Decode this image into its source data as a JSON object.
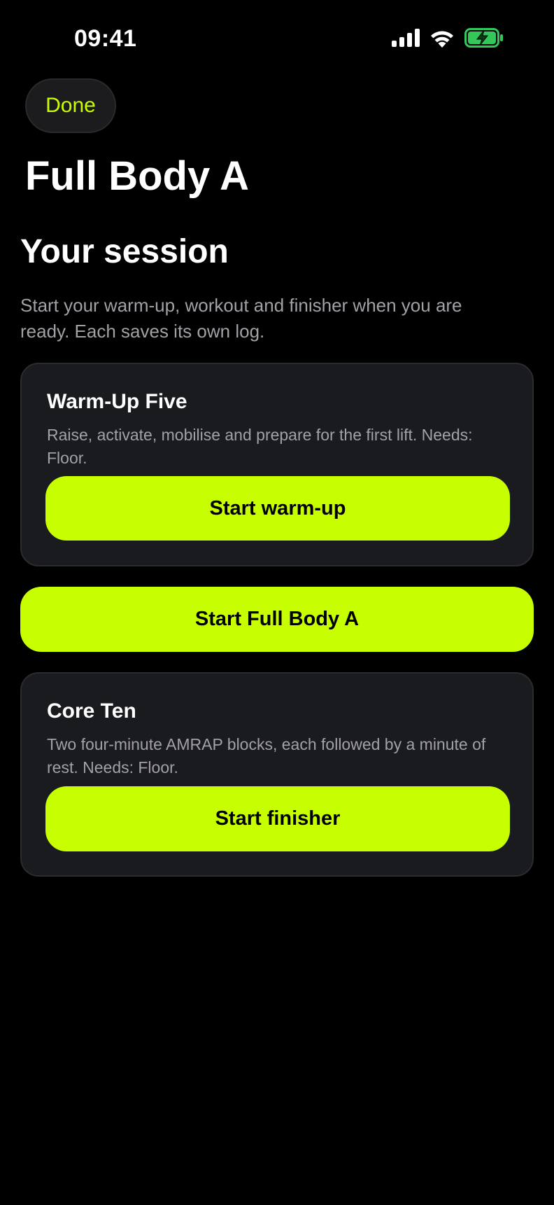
{
  "status_bar": {
    "time": "09:41",
    "icons": [
      "signal-icon",
      "wifi-icon",
      "battery-charging-icon"
    ]
  },
  "nav": {
    "done_label": "Done"
  },
  "page_title": "Full Body A",
  "session": {
    "title": "Your session",
    "description": "Start your warm-up, workout and finisher when you are ready. Each saves its own log."
  },
  "warmup": {
    "title": "Warm-Up Five",
    "description": "Raise, activate, mobilise and prepare for the first lift. Needs: Floor.",
    "button_label": "Start warm-up"
  },
  "workout": {
    "button_label": "Start Full Body A"
  },
  "finisher": {
    "title": "Core Ten",
    "description": "Two four-minute AMRAP blocks, each followed by a minute of rest. Needs: Floor.",
    "button_label": "Start finisher"
  },
  "colors": {
    "accent": "#c8ff00",
    "background": "#000000",
    "card": "#1a1b1e",
    "secondary_text": "#a1a1a6",
    "battery": "#34c759"
  }
}
